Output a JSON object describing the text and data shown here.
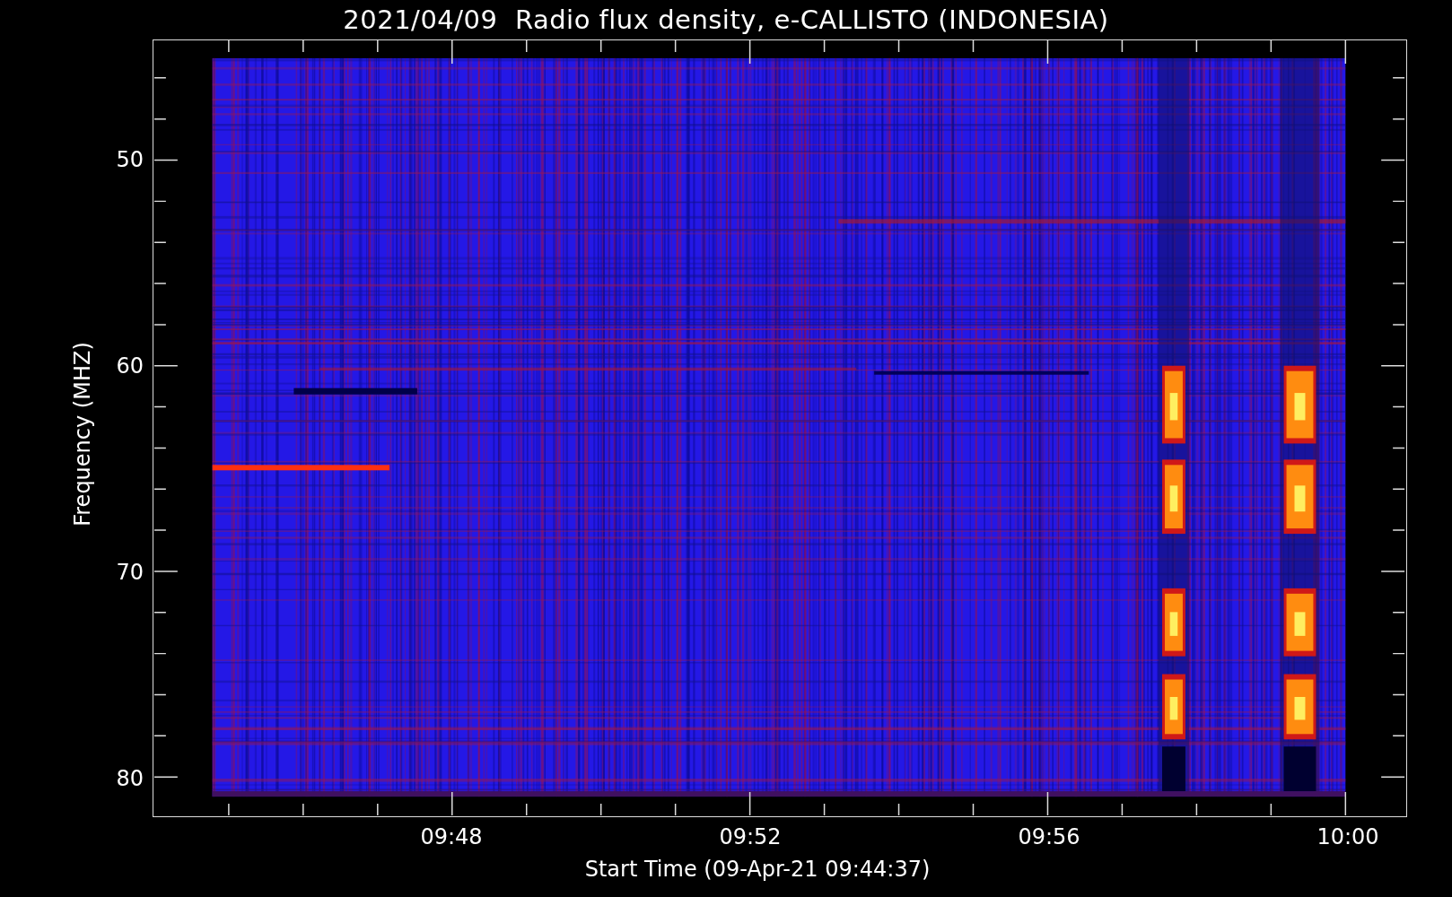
{
  "title": "2021/04/09  Radio flux density, e-CALLISTO (INDONESIA)",
  "y_axis": {
    "label": "Frequency (MHZ)",
    "ticks": [
      "50",
      "60",
      "70",
      "80"
    ]
  },
  "x_axis": {
    "label": "Start Time (09-Apr-21 09:44:37)",
    "ticks": [
      "09:48",
      "09:52",
      "09:56",
      "10:00"
    ]
  }
}
